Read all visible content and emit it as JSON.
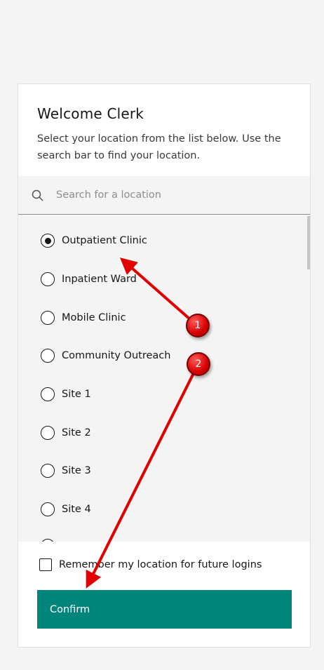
{
  "title": "Welcome Clerk",
  "subtitle": "Select your location from the list below. Use the search bar to find your location.",
  "search": {
    "placeholder": "Search for a location",
    "value": ""
  },
  "locations": [
    {
      "label": "Outpatient Clinic",
      "checked": true
    },
    {
      "label": "Inpatient Ward",
      "checked": false
    },
    {
      "label": "Mobile Clinic",
      "checked": false
    },
    {
      "label": "Community Outreach",
      "checked": false
    },
    {
      "label": "Site 1",
      "checked": false
    },
    {
      "label": "Site 2",
      "checked": false
    },
    {
      "label": "Site 3",
      "checked": false
    },
    {
      "label": "Site 4",
      "checked": false
    }
  ],
  "remember": {
    "label": "Remember my location for future logins",
    "checked": false
  },
  "confirm_label": "Confirm",
  "annotations": [
    {
      "number": "1"
    },
    {
      "number": "2"
    }
  ],
  "colors": {
    "primary": "#00857c",
    "annotation": "#e00000"
  }
}
